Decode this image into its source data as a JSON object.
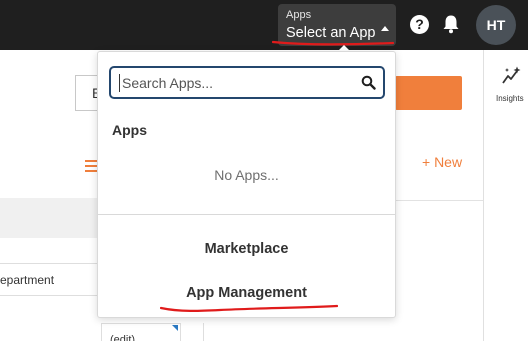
{
  "topbar": {
    "app_selector": {
      "small_label": "Apps",
      "main_label": "Select an App"
    },
    "help_icon": "?",
    "avatar_initials": "HT"
  },
  "background": {
    "input_fragment": "E",
    "new_link": "+ New",
    "column_header": "epartment",
    "cell_edit": "(edit)",
    "insights_label": "Insights"
  },
  "dropdown": {
    "search_placeholder": "Search Apps...",
    "apps_heading": "Apps",
    "empty_message": "No Apps...",
    "links": {
      "marketplace": "Marketplace",
      "app_management": "App Management"
    }
  },
  "colors": {
    "topbar_bg": "#1f1f1f",
    "accent_orange": "#f07f3c",
    "search_border": "#24476e",
    "annotation_red": "#e01b1b"
  },
  "icons": [
    "help-icon",
    "bell-icon",
    "search-icon",
    "insights-icon",
    "hamburger-icon",
    "caret-up-icon"
  ]
}
